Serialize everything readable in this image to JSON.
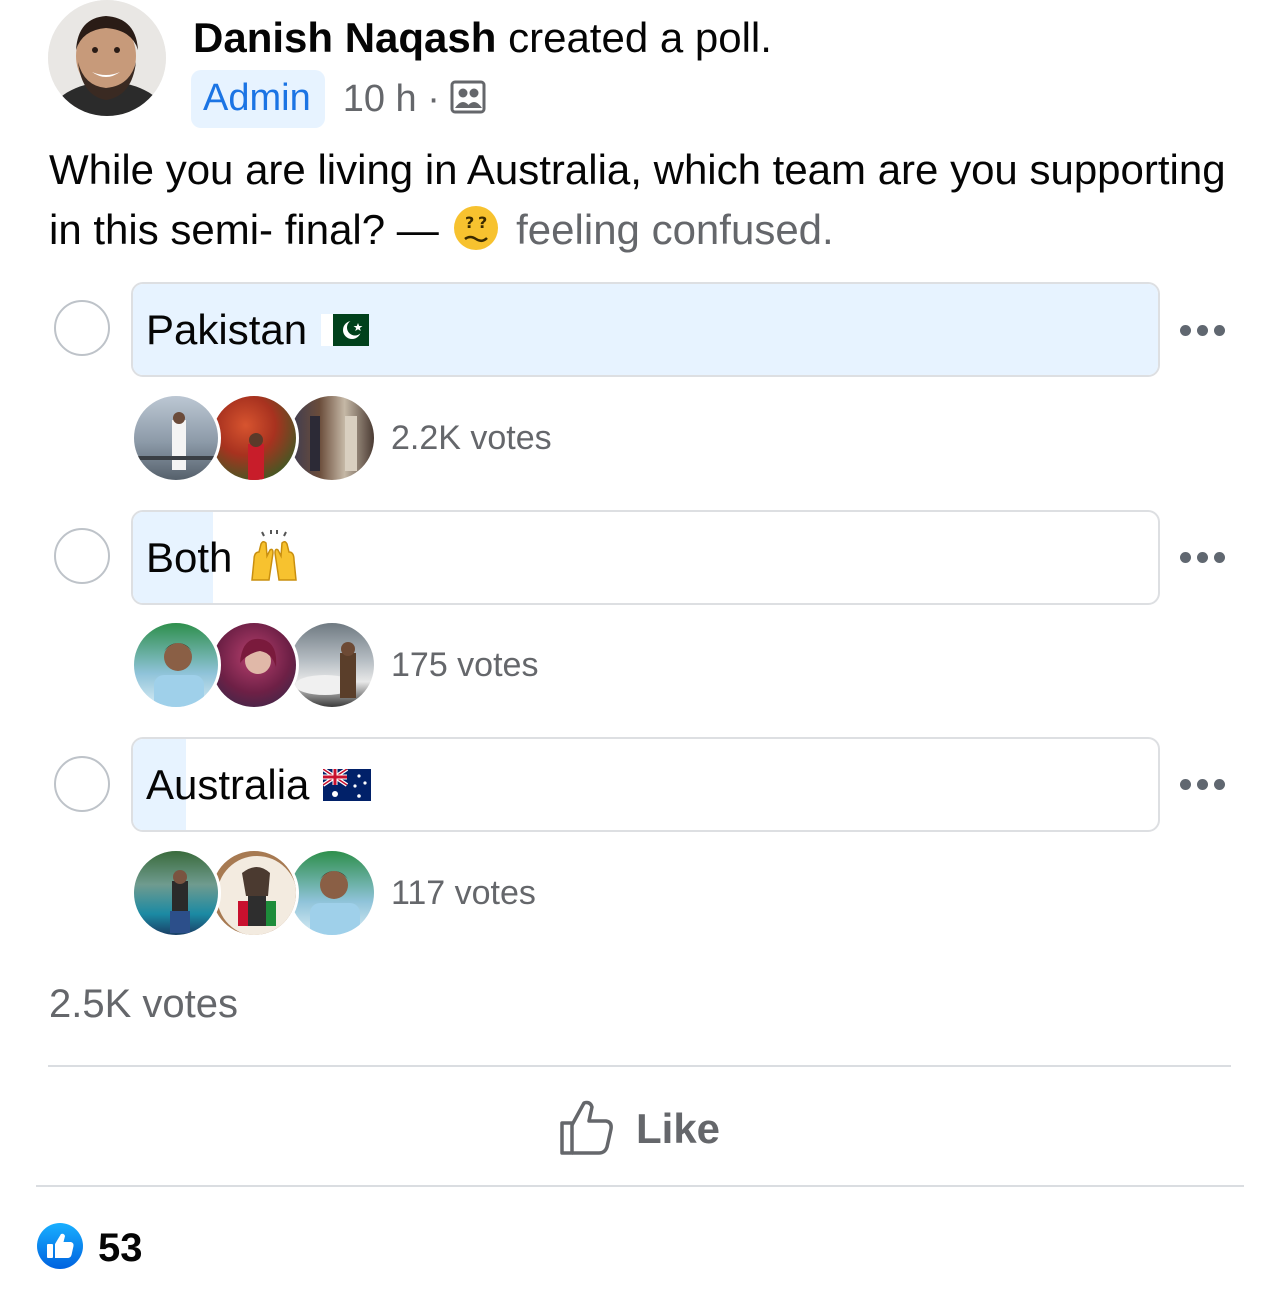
{
  "post": {
    "author": "Danish Naqash",
    "action": "created a poll.",
    "badge": "Admin",
    "timestamp": "10 h ·",
    "audience_icon": "group-icon",
    "question": "While you are living in Australia, which team are you supporting in this semi- final? —",
    "feeling_emoji": "confused-face-emoji",
    "feeling_text": "feeling confused."
  },
  "poll": {
    "options": [
      {
        "label": "Pakistan",
        "emoji": "pakistan-flag",
        "votes": "2.2K votes",
        "fill_fraction": 1.0
      },
      {
        "label": "Both",
        "emoji": "raising-hands-emoji",
        "votes": "175 votes",
        "fill_fraction": 0.078
      },
      {
        "label": "Australia",
        "emoji": "australia-flag",
        "votes": "117 votes",
        "fill_fraction": 0.052
      }
    ],
    "total_votes": "2.5K votes"
  },
  "actions": {
    "like_label": "Like",
    "like_icon": "thumbs-up-icon"
  },
  "reactions": {
    "icon": "like-reaction-icon",
    "count": "53"
  },
  "colors": {
    "accent": "#1b74e4",
    "poll_fill": "#e7f3ff",
    "secondary_text": "#65676b",
    "border": "#dddfe2"
  }
}
